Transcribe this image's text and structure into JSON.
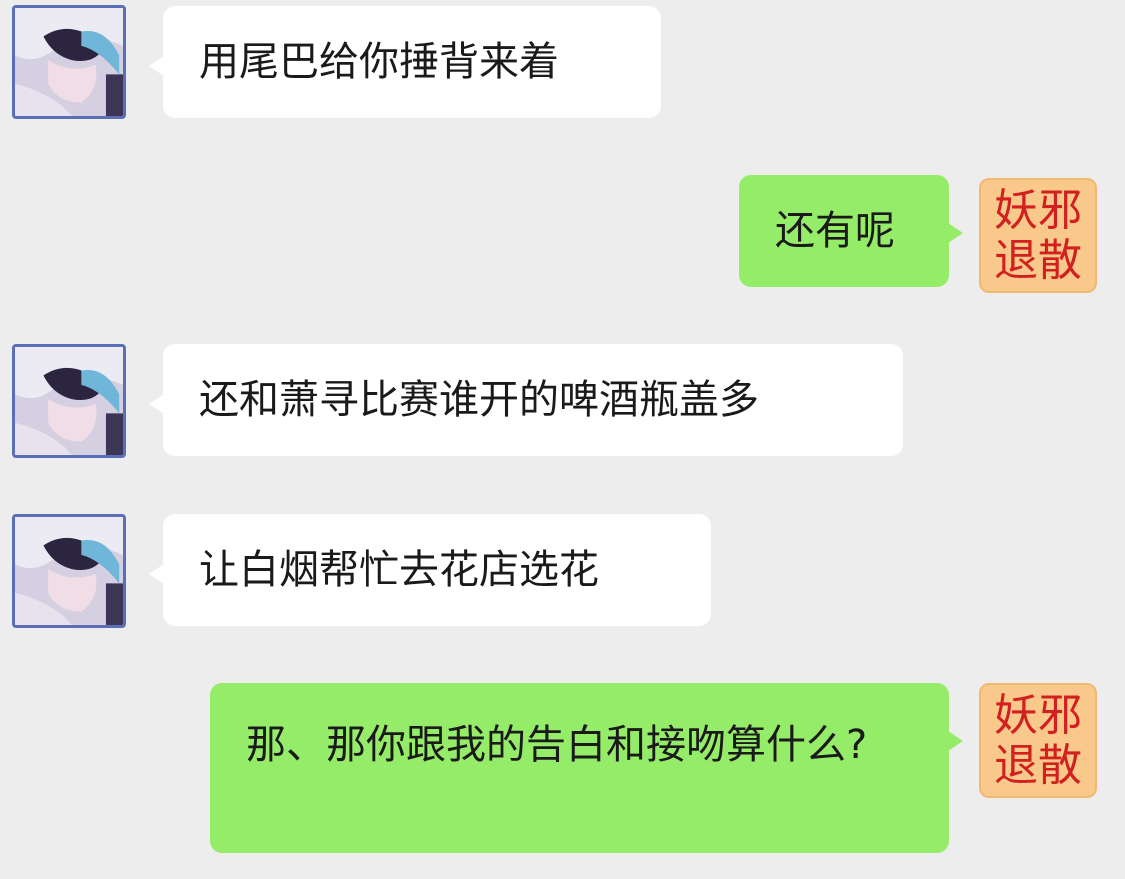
{
  "messages": [
    {
      "side": "left",
      "text": "用尾巴给你捶背来着"
    },
    {
      "side": "right",
      "text": "还有呢",
      "avatar_text": "妖邪退散"
    },
    {
      "side": "left",
      "text": "还和萧寻比赛谁开的啤酒瓶盖多"
    },
    {
      "side": "left",
      "text": "让白烟帮忙去花店选花"
    },
    {
      "side": "right",
      "text": "那、那你跟我的告白和接吻算什么?",
      "avatar_text": "妖邪退散"
    }
  ],
  "colors": {
    "background": "#ededed",
    "left_bubble": "#ffffff",
    "right_bubble": "#95ec69",
    "seal_background": "#f9c98b",
    "seal_text": "#d21f1f"
  },
  "icons": {
    "left_avatar": "anime-character-avatar",
    "right_avatar": "seal-avatar"
  }
}
